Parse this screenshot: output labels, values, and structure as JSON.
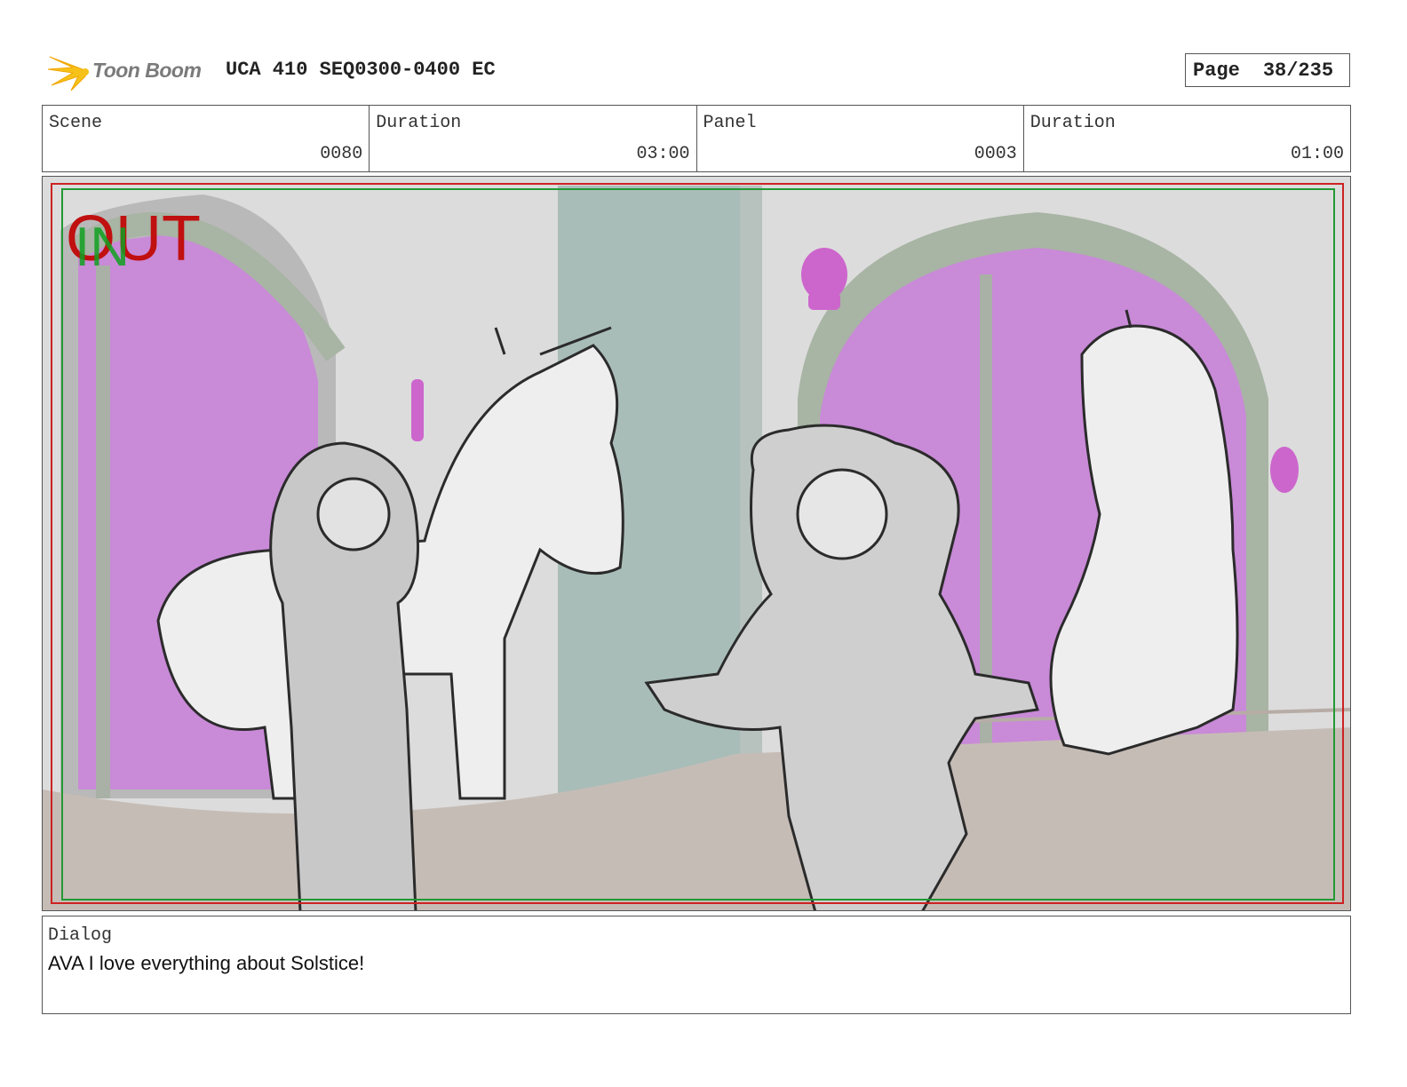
{
  "header": {
    "brand": "Toon Boom",
    "doc_title": "UCA 410 SEQ0300-0400 EC",
    "page_label": "Page",
    "page_value": "38/235"
  },
  "info": {
    "scene_label": "Scene",
    "scene_value": "0080",
    "duration_label": "Duration",
    "duration_value": "03:00",
    "panel_label": "Panel",
    "panel_value": "0003",
    "panel_duration_label": "Duration",
    "panel_duration_value": "01:00"
  },
  "panel": {
    "marker_out": "OUT",
    "marker_in": "IN",
    "colors": {
      "out": "#c01010",
      "in": "#10a020",
      "magenta": "#c98ad8",
      "frame_red": "#cc2222",
      "frame_green": "#229933"
    }
  },
  "dialog": {
    "label": "Dialog",
    "text": "AVA I love everything about Solstice!"
  }
}
